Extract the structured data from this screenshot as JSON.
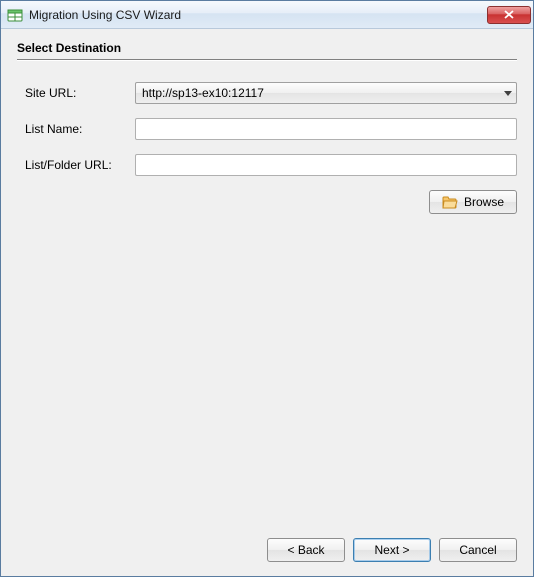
{
  "window": {
    "title": "Migration Using CSV Wizard"
  },
  "page": {
    "heading": "Select Destination"
  },
  "form": {
    "siteUrl": {
      "label": "Site URL:",
      "value": "http://sp13-ex10:12117"
    },
    "listName": {
      "label": "List Name:",
      "value": ""
    },
    "listFolderUrl": {
      "label": "List/Folder URL:",
      "value": ""
    },
    "browse": {
      "label": "Browse"
    }
  },
  "footer": {
    "back": "< Back",
    "next": "Next >",
    "cancel": "Cancel"
  }
}
